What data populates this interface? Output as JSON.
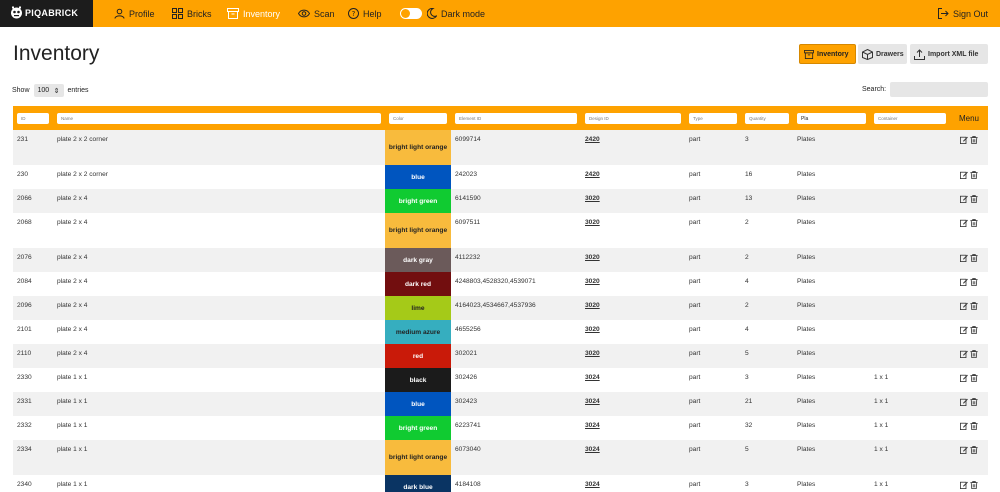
{
  "brand": {
    "name": "PIQABRICK"
  },
  "nav": {
    "profile": "Profile",
    "bricks": "Bricks",
    "inventory": "Inventory",
    "scan": "Scan",
    "help": "Help",
    "dark_mode": "Dark mode",
    "sign_out": "Sign Out"
  },
  "page": {
    "title": "Inventory"
  },
  "buttons": {
    "inventory": "Inventory",
    "drawers": "Drawers",
    "import": "Import XML file"
  },
  "controls": {
    "show_label": "Show",
    "entries_value": "100",
    "entries_label": "entries",
    "search_label": "Search:"
  },
  "table": {
    "filters": {
      "id": "ID",
      "name": "Name",
      "color": "Color",
      "element_id": "Element ID",
      "design_id": "Design ID",
      "type": "Type",
      "quantity": "Quantity",
      "category": "Pla",
      "container": "Container"
    },
    "menu_header": "Menu",
    "rows": [
      {
        "id": "231",
        "name": "plate 2 x 2 corner",
        "color": "bright light orange",
        "color_hex": "#f8bb3d",
        "dark_text": true,
        "element_id": "6099714",
        "design_id": "2420",
        "type": "part",
        "quantity": "3",
        "category": "Plates",
        "container": ""
      },
      {
        "id": "230",
        "name": "plate 2 x 2 corner",
        "color": "blue",
        "color_hex": "#0055bf",
        "dark_text": false,
        "element_id": "242023",
        "design_id": "2420",
        "type": "part",
        "quantity": "16",
        "category": "Plates",
        "container": ""
      },
      {
        "id": "2066",
        "name": "plate 2 x 4",
        "color": "bright green",
        "color_hex": "#10cb31",
        "dark_text": false,
        "element_id": "6141590",
        "design_id": "3020",
        "type": "part",
        "quantity": "13",
        "category": "Plates",
        "container": ""
      },
      {
        "id": "2068",
        "name": "plate 2 x 4",
        "color": "bright light orange",
        "color_hex": "#f8bb3d",
        "dark_text": true,
        "element_id": "6097511",
        "design_id": "3020",
        "type": "part",
        "quantity": "2",
        "category": "Plates",
        "container": ""
      },
      {
        "id": "2076",
        "name": "plate 2 x 4",
        "color": "dark gray",
        "color_hex": "#6b5a5a",
        "dark_text": false,
        "element_id": "4112232",
        "design_id": "3020",
        "type": "part",
        "quantity": "2",
        "category": "Plates",
        "container": ""
      },
      {
        "id": "2084",
        "name": "plate 2 x 4",
        "color": "dark red",
        "color_hex": "#720e0f",
        "dark_text": false,
        "element_id": "4248803,4528320,4539071",
        "design_id": "3020",
        "type": "part",
        "quantity": "4",
        "category": "Plates",
        "container": ""
      },
      {
        "id": "2096",
        "name": "plate 2 x 4",
        "color": "lime",
        "color_hex": "#a5ca18",
        "dark_text": true,
        "element_id": "4164023,4534667,4537936",
        "design_id": "3020",
        "type": "part",
        "quantity": "2",
        "category": "Plates",
        "container": ""
      },
      {
        "id": "2101",
        "name": "plate 2 x 4",
        "color": "medium azure",
        "color_hex": "#36aebf",
        "dark_text": true,
        "element_id": "4655256",
        "design_id": "3020",
        "type": "part",
        "quantity": "4",
        "category": "Plates",
        "container": ""
      },
      {
        "id": "2110",
        "name": "plate 2 x 4",
        "color": "red",
        "color_hex": "#c91a09",
        "dark_text": false,
        "element_id": "302021",
        "design_id": "3020",
        "type": "part",
        "quantity": "5",
        "category": "Plates",
        "container": ""
      },
      {
        "id": "2330",
        "name": "plate 1 x 1",
        "color": "black",
        "color_hex": "#1b1b1b",
        "dark_text": false,
        "element_id": "302426",
        "design_id": "3024",
        "type": "part",
        "quantity": "3",
        "category": "Plates",
        "container": "1 x 1"
      },
      {
        "id": "2331",
        "name": "plate 1 x 1",
        "color": "blue",
        "color_hex": "#0055bf",
        "dark_text": false,
        "element_id": "302423",
        "design_id": "3024",
        "type": "part",
        "quantity": "21",
        "category": "Plates",
        "container": "1 x 1"
      },
      {
        "id": "2332",
        "name": "plate 1 x 1",
        "color": "bright green",
        "color_hex": "#10cb31",
        "dark_text": false,
        "element_id": "6223741",
        "design_id": "3024",
        "type": "part",
        "quantity": "32",
        "category": "Plates",
        "container": "1 x 1"
      },
      {
        "id": "2334",
        "name": "plate 1 x 1",
        "color": "bright light orange",
        "color_hex": "#f8bb3d",
        "dark_text": true,
        "element_id": "6073040",
        "design_id": "3024",
        "type": "part",
        "quantity": "5",
        "category": "Plates",
        "container": "1 x 1"
      },
      {
        "id": "2340",
        "name": "plate 1 x 1",
        "color": "dark blue",
        "color_hex": "#0a3463",
        "dark_text": false,
        "element_id": "4184108",
        "design_id": "3024",
        "type": "part",
        "quantity": "3",
        "category": "Plates",
        "container": "1 x 1"
      }
    ]
  }
}
